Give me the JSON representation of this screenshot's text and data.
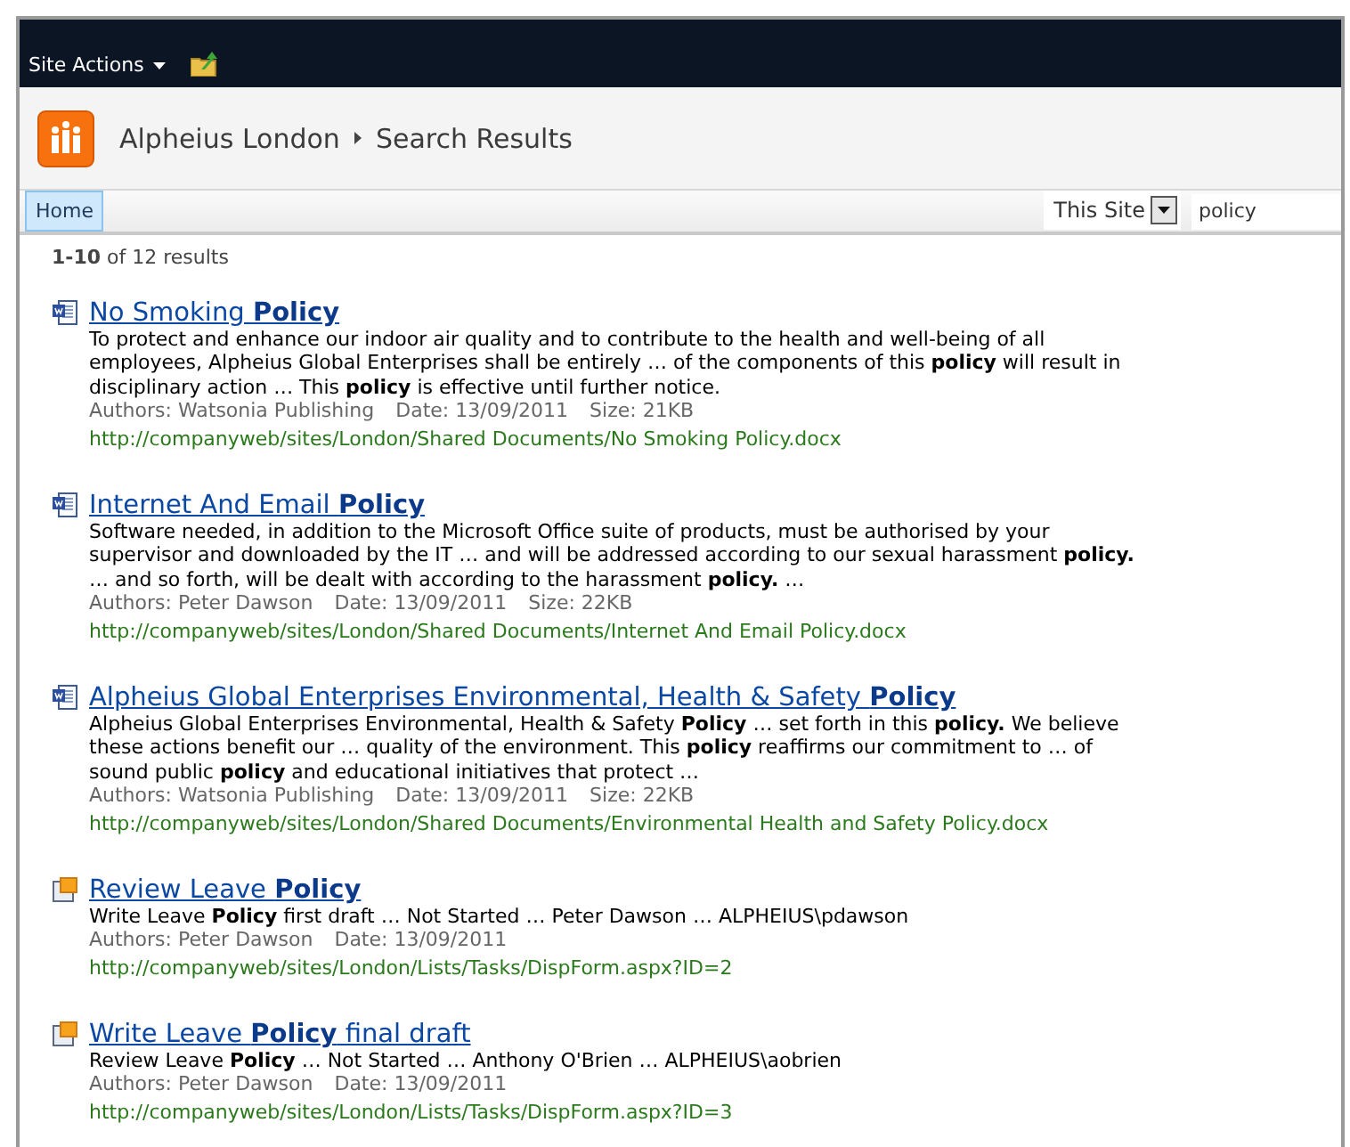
{
  "top_bar": {
    "site_actions": "Site Actions"
  },
  "header": {
    "site": "Alpheius London",
    "page": "Search Results"
  },
  "nav": {
    "tabs": [
      {
        "label": "Home",
        "selected": true
      }
    ]
  },
  "search": {
    "scope": "This Site",
    "query": "policy"
  },
  "results_count": "**1-10** of 12 results",
  "results": [
    {
      "kind": "document",
      "title": "No Smoking **Policy**",
      "summary": "To protect and enhance our indoor air quality and to contribute to the health and well-being of all employees, Alpheius Global Enterprises shall be entirely … of the components of this **policy** will result in disciplinary action … This **policy** is effective until further notice.",
      "author": "Authors: Watsonia Publishing",
      "date": "Date: 13/09/2011",
      "size": "Size: 21KB",
      "url": "http://companyweb/sites/London/Shared Documents/No Smoking Policy.docx"
    },
    {
      "kind": "document",
      "title": "Internet And Email **Policy**",
      "summary": "Software needed, in addition to the Microsoft Office suite of products, must be authorised by your supervisor and downloaded by the IT … and will be addressed according to our sexual harassment **policy.** … and so forth, will be dealt with according to the harassment **policy.** …",
      "author": "Authors: Peter Dawson",
      "date": "Date: 13/09/2011",
      "size": "Size: 22KB",
      "url": "http://companyweb/sites/London/Shared Documents/Internet And Email Policy.docx"
    },
    {
      "kind": "document",
      "title": "Alpheius Global Enterprises Environmental, Health & Safety **Policy**",
      "summary": "Alpheius Global Enterprises Environmental, Health & Safety **Policy** … set forth in this **policy.** We believe these actions benefit our … quality of the environment. This **policy** reaffirms our commitment to … of sound public **policy** and educational initiatives that protect …",
      "author": "Authors: Watsonia Publishing",
      "date": "Date: 13/09/2011",
      "size": "Size: 22KB",
      "url": "http://companyweb/sites/London/Shared Documents/Environmental Health and Safety Policy.docx"
    },
    {
      "kind": "task",
      "title": "Review Leave **Policy**",
      "summary": "Write Leave **Policy** first draft … Not Started … Peter Dawson … ALPHEIUS\\pdawson",
      "author": "Authors: Peter Dawson",
      "date": "Date: 13/09/2011",
      "url": "http://companyweb/sites/London/Lists/Tasks/DispForm.aspx?ID=2"
    },
    {
      "kind": "task",
      "title": "Write Leave **Policy** final draft",
      "summary": "Review Leave **Policy** … Not Started … Anthony O'Brien … ALPHEIUS\\aobrien",
      "author": "Authors: Peter Dawson",
      "date": "Date: 13/09/2011",
      "url": "http://companyweb/sites/London/Lists/Tasks/DispForm.aspx?ID=3"
    }
  ]
}
